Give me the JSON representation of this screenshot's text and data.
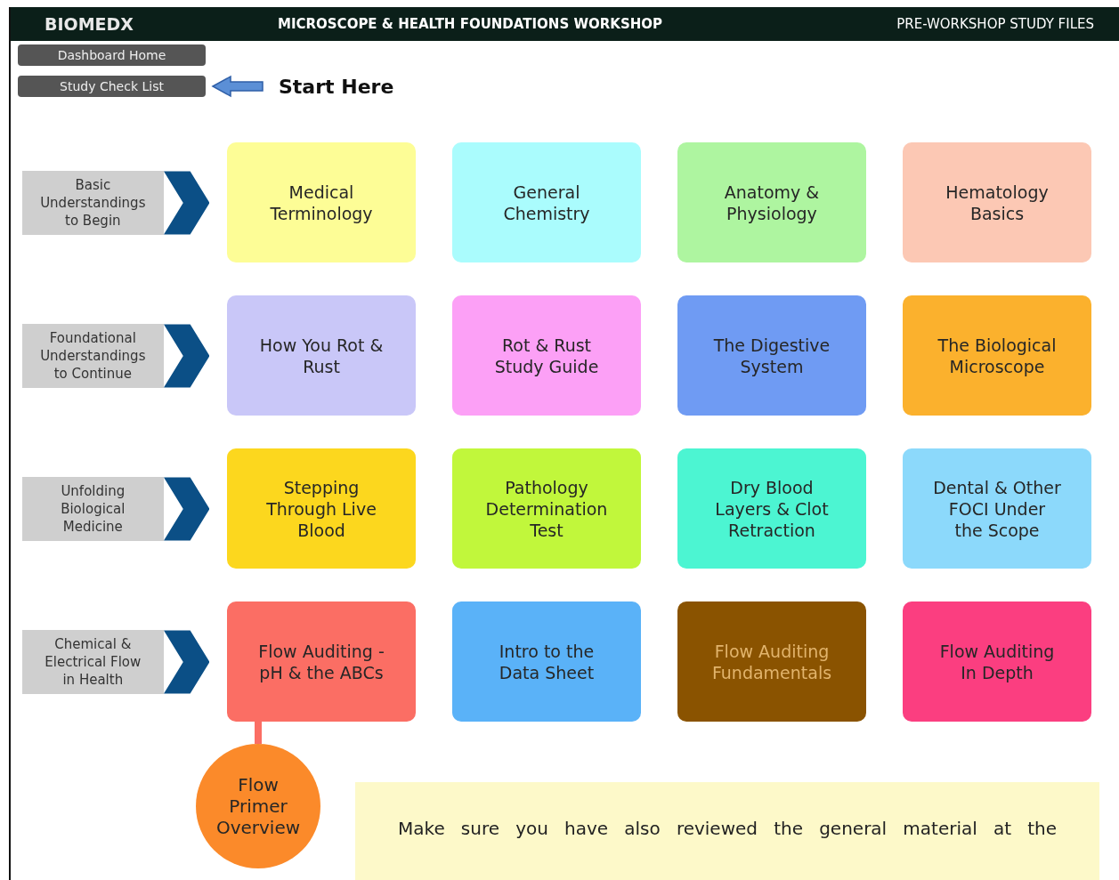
{
  "header": {
    "brand": "BIOMEDX",
    "title": "MICROSCOPE & HEALTH FOUNDATIONS WORKSHOP",
    "section": "PRE-WORKSHOP STUDY FILES"
  },
  "nav_buttons": [
    "Dashboard Home",
    "Study Check List"
  ],
  "start_hint": "Start Here",
  "rows": [
    {
      "label": "Basic Understandings to Begin",
      "cards": [
        {
          "title": "Medical Terminology",
          "color": "#fdfd96"
        },
        {
          "title": "General Chemistry",
          "color": "#aafcfd"
        },
        {
          "title": "Anatomy & Physiology",
          "color": "#aef5a0"
        },
        {
          "title": "Hematology Basics",
          "color": "#fcc8b4"
        }
      ]
    },
    {
      "label": "Foundational Understandings to Continue",
      "cards": [
        {
          "title": "How You Rot & Rust",
          "color": "#c9c7f8"
        },
        {
          "title": "Rot & Rust Study Guide",
          "color": "#fca0f6"
        },
        {
          "title": "The Digestive System",
          "color": "#6f9bf3"
        },
        {
          "title": "The Biological Microscope",
          "color": "#fbb12d"
        }
      ]
    },
    {
      "label": "Unfolding Biological Medicine",
      "cards": [
        {
          "title": "Stepping Through Live Blood",
          "color": "#fcd71e"
        },
        {
          "title": "Pathology Determination Test",
          "color": "#c1f73b"
        },
        {
          "title": "Dry Blood Layers & Clot Retraction",
          "color": "#4cf5d2"
        },
        {
          "title": "Dental & Other FOCI Under the Scope",
          "color": "#8cd9fb"
        }
      ]
    },
    {
      "label": "Chemical & Electrical Flow in Health",
      "cards": [
        {
          "title": "Flow Auditing - pH & the ABCs",
          "color": "#fb6e64"
        },
        {
          "title": "Intro to the Data Sheet",
          "color": "#5ab2f8"
        },
        {
          "title": "Flow Auditing Fundamentals",
          "color": "#8a5300"
        },
        {
          "title": "Flow Auditing In Depth",
          "color": "#fb3e80"
        }
      ]
    }
  ],
  "primer": {
    "title": "Flow Primer Overview",
    "color": "#fb8a2a"
  },
  "note": "Make sure you have also reviewed the general material at the"
}
